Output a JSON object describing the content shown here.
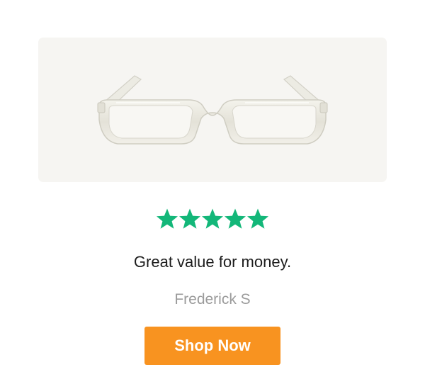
{
  "product": {
    "image_icon": "clear-reading-glasses-image"
  },
  "rating": {
    "stars": 5,
    "max_stars": 5,
    "color": "#13b779"
  },
  "review": {
    "text": "Great value for money.",
    "author": "Frederick S"
  },
  "cta": {
    "label": "Shop Now",
    "color": "#f89320"
  }
}
